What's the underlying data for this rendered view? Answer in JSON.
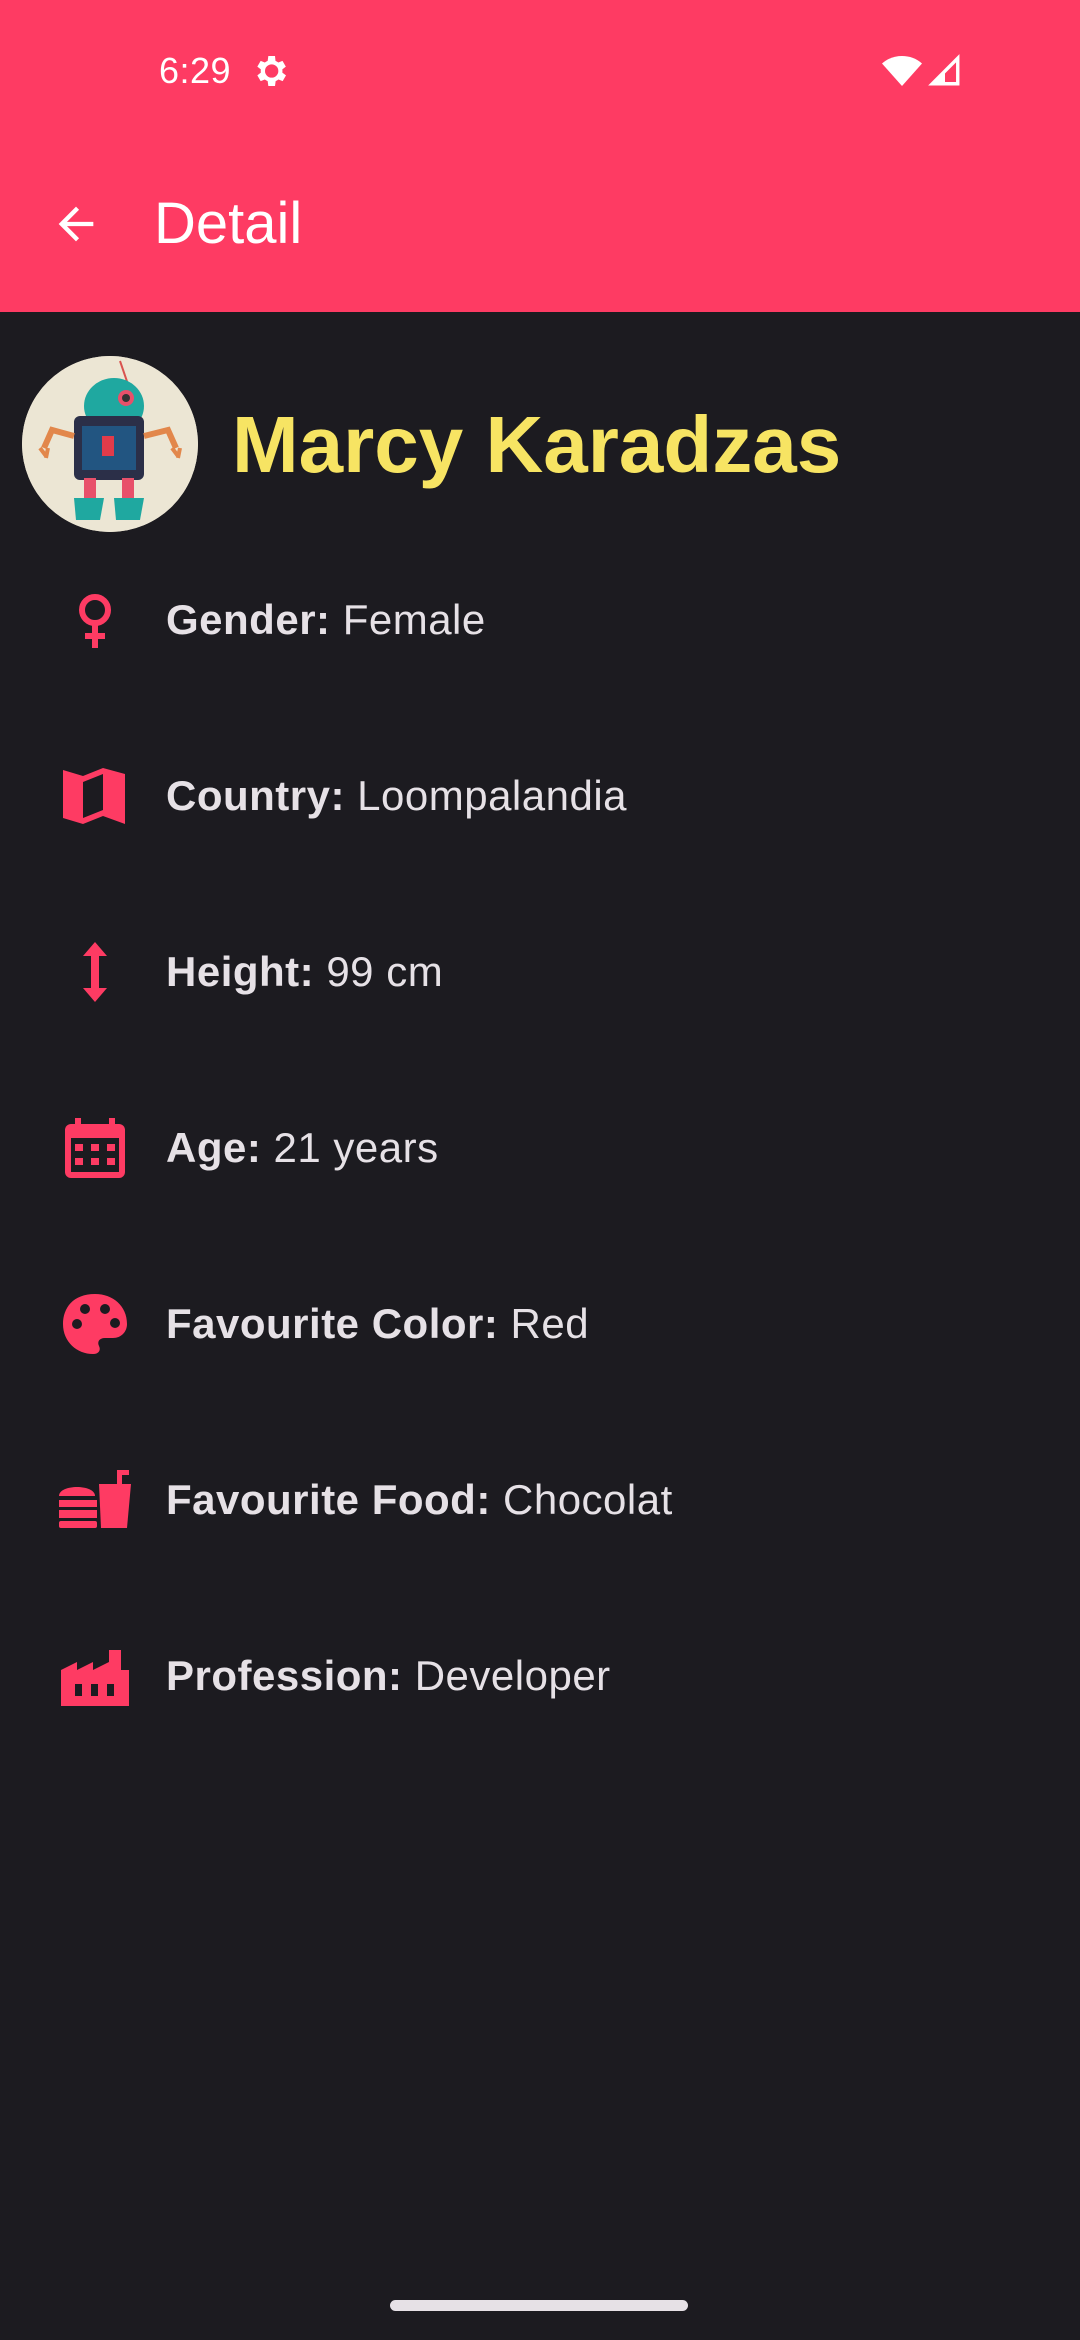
{
  "status_bar": {
    "time": "6:29",
    "icons": [
      "settings-icon",
      "wifi-icon",
      "cell-signal-icon"
    ]
  },
  "toolbar": {
    "back_icon": "arrow-back-icon",
    "title": "Detail"
  },
  "profile": {
    "avatar": "robot-avatar",
    "name": "Marcy Karadzas"
  },
  "details": {
    "gender": {
      "icon": "female-icon",
      "label": "Gender:",
      "value": "Female"
    },
    "country": {
      "icon": "map-icon",
      "label": "Country:",
      "value": "Loompalandia"
    },
    "height": {
      "icon": "height-icon",
      "label": "Height:",
      "value": "99 cm"
    },
    "age": {
      "icon": "calendar-icon",
      "label": "Age:",
      "value": "21 years"
    },
    "color": {
      "icon": "palette-icon",
      "label": "Favourite Color:",
      "value": "Red"
    },
    "food": {
      "icon": "fastfood-icon",
      "label": "Favourite Food:",
      "value": "Chocolat"
    },
    "profession": {
      "icon": "factory-icon",
      "label": "Profession:",
      "value": "Developer"
    }
  },
  "colors": {
    "accent": "#fe3b63",
    "background": "#1c1b20",
    "name_color": "#f7e463",
    "text": "#e6e1e6"
  }
}
